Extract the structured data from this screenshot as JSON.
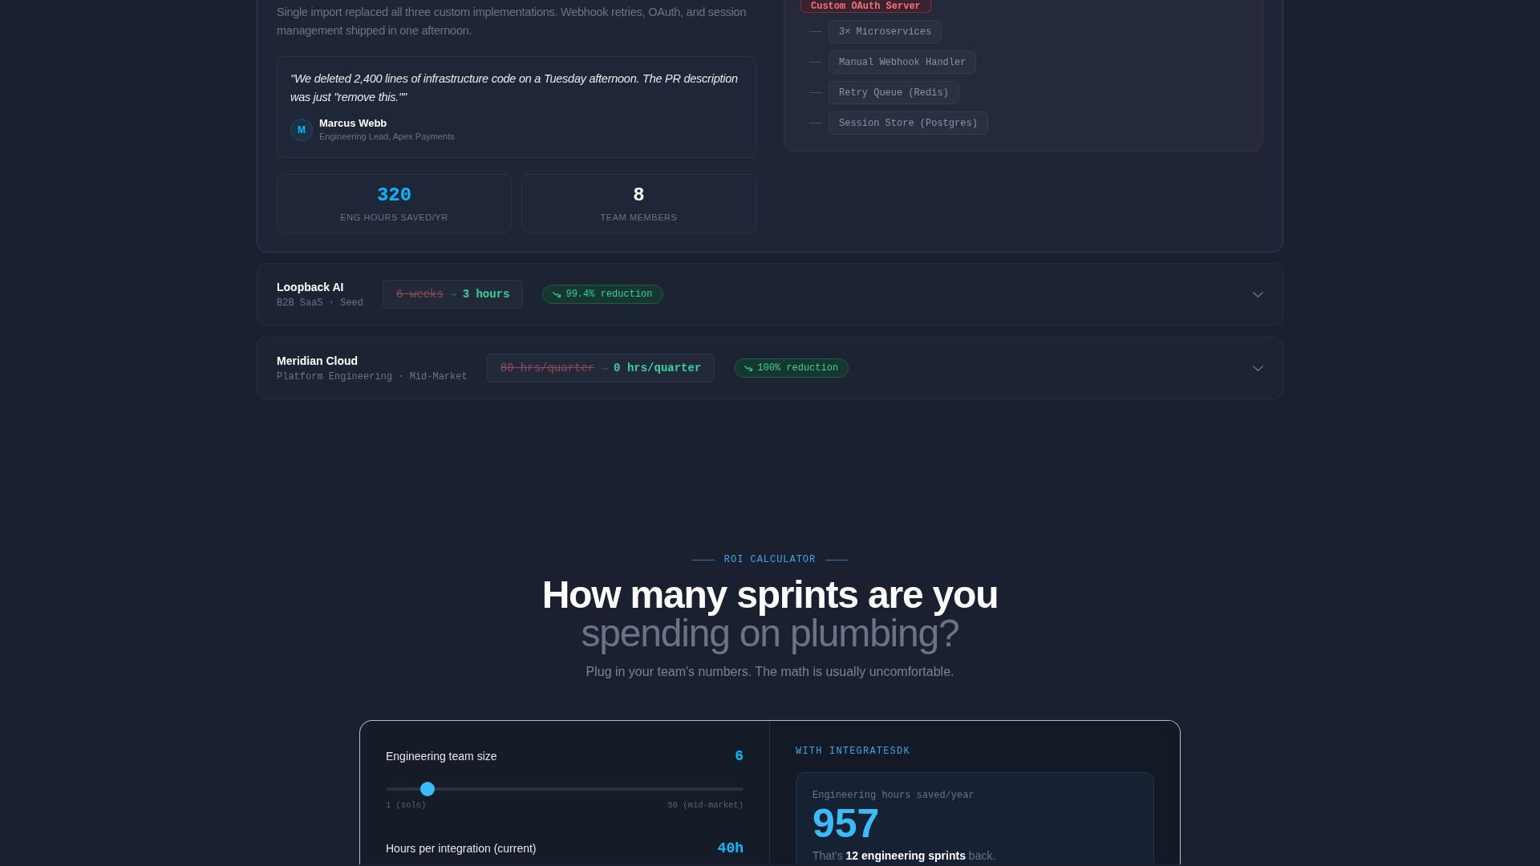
{
  "case_study": {
    "description": "Single import replaced all three custom implementations. Webhook retries, OAuth, and session management shipped in one afternoon.",
    "quote": {
      "text": "\"We deleted 2,400 lines of infrastructure code on a Tuesday afternoon. The PR description was just \"remove this.\"\"",
      "avatar": "M",
      "author": "Marcus Webb",
      "role": "Engineering Lead, Apex Payments"
    },
    "stats": [
      {
        "value": "320",
        "label": "ENG HOURS SAVED/YR",
        "highlighted": true
      },
      {
        "value": "8",
        "label": "TEAM MEMBERS",
        "highlighted": false
      }
    ],
    "architecture": {
      "label": "Custom OAuth Server",
      "children": [
        {
          "label": "3× Microservices"
        },
        {
          "label": "Manual Webhook Handler"
        },
        {
          "label": "Retry Queue (Redis)"
        },
        {
          "label": "Session Store (Postgres)"
        }
      ]
    }
  },
  "case_rows": [
    {
      "company": "Loopback AI",
      "meta": "B2B SaaS · Seed",
      "before": "6 weeks",
      "arrow": "→",
      "after": "3 hours",
      "reduction": "99.4% reduction",
      "expanded": false
    },
    {
      "company": "Meridian Cloud",
      "meta": "Platform Engineering · Mid-Market",
      "before": "80 hrs/quarter",
      "arrow": "→",
      "after": "0 hrs/quarter",
      "reduction": "100% reduction",
      "expanded": false
    }
  ],
  "roi": {
    "eyebrow": "ROI CALCULATOR",
    "heading": "**How many sprints are you** spending on plumbing?",
    "subtitle": "Plug in your team's numbers. The math is usually uncomfortable.",
    "inputs": [
      {
        "kind": "slider",
        "label": "Engineering team size",
        "value": "6",
        "level": 0.1,
        "min_label": "1 (solo)",
        "max_label": "50 (mid-market)"
      },
      {
        "kind": "number",
        "label": "Hours per integration (current)",
        "value": "40h"
      }
    ],
    "result": {
      "heading": "WITH INTEGRATESDK",
      "metric_label": "Engineering hours saved/year",
      "metric_value": "957",
      "summary": "That's **12 engineering sprints** back."
    }
  }
}
